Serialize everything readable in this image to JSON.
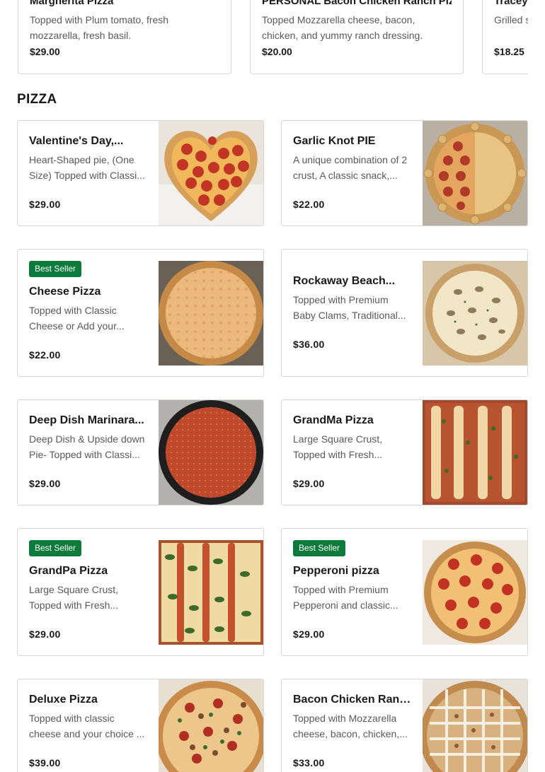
{
  "carousel": [
    {
      "name": "Margherita Pizza",
      "desc": "Topped with Plum tomato, fresh mozzarella, fresh basil.",
      "price": "$29.00"
    },
    {
      "name": "PERSONAL Bacon Chicken Ranch Pizza",
      "desc": "Topped Mozzarella cheese, bacon, chicken, and yummy ranch dressing.",
      "price": "$20.00"
    },
    {
      "name": "Tracey's",
      "desc": "Grilled s served c",
      "price": "$18.25"
    }
  ],
  "section": {
    "title": "PIZZA"
  },
  "items": [
    {
      "name": "Valentine's Day,...",
      "desc": "Heart-Shaped pie, (One Size) Topped with Classi...",
      "price": "$29.00",
      "badge": ""
    },
    {
      "name": "Garlic Knot PIE",
      "desc": "A unique combination of 2 crust, A classic snack,...",
      "price": "$22.00",
      "badge": ""
    },
    {
      "name": "Cheese Pizza",
      "desc": "Topped with Classic Cheese or Add your...",
      "price": "$22.00",
      "badge": "Best Seller"
    },
    {
      "name": "Rockaway Beach...",
      "desc": "Topped with Premium Baby Clams, Traditional...",
      "price": "$36.00",
      "badge": ""
    },
    {
      "name": "Deep Dish Marinara...",
      "desc": "Deep Dish & Upside down Pie- Topped with Classi...",
      "price": "$29.00",
      "badge": ""
    },
    {
      "name": "GrandMa Pizza",
      "desc": "Large Square Crust, Topped with Fresh...",
      "price": "$29.00",
      "badge": ""
    },
    {
      "name": "GrandPa Pizza",
      "desc": "Large Square Crust, Topped with Fresh...",
      "price": "$29.00",
      "badge": "Best Seller"
    },
    {
      "name": "Pepperoni pizza",
      "desc": "Topped with Premium Pepperoni and classic...",
      "price": "$29.00",
      "badge": "Best Seller"
    },
    {
      "name": "Deluxe Pizza",
      "desc": "Topped with classic cheese and your choice ...",
      "price": "$39.00",
      "badge": ""
    },
    {
      "name": "Bacon Chicken Ranc...",
      "desc": "Topped with Mozzarella cheese, bacon, chicken,...",
      "price": "$33.00",
      "badge": ""
    }
  ],
  "colors": {
    "badge": "#0b7a3a",
    "border": "#d6d6d6",
    "desc": "#595959",
    "text": "#191919"
  }
}
